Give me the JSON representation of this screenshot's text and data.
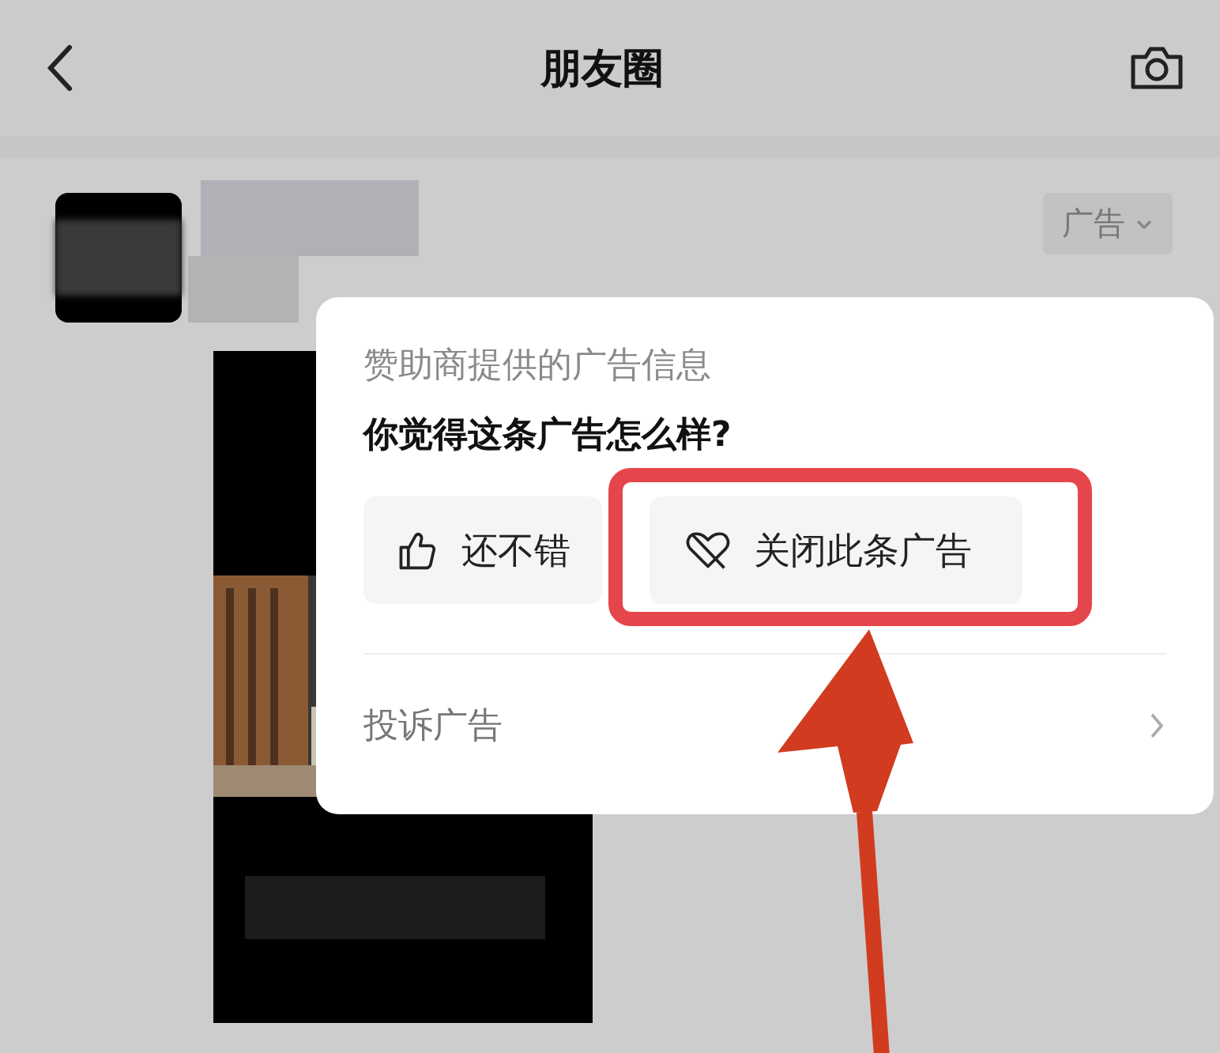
{
  "header": {
    "title": "朋友圈"
  },
  "post": {
    "ad_tag": "广告"
  },
  "ad_menu": {
    "caption": "赞助商提供的广告信息",
    "question": "你觉得这条广告怎么样?",
    "actions": [
      {
        "label": "还不错",
        "kind": "like",
        "highlighted": false
      },
      {
        "label": "关闭此条广告",
        "kind": "close",
        "highlighted": true
      }
    ],
    "report": "投诉广告"
  }
}
